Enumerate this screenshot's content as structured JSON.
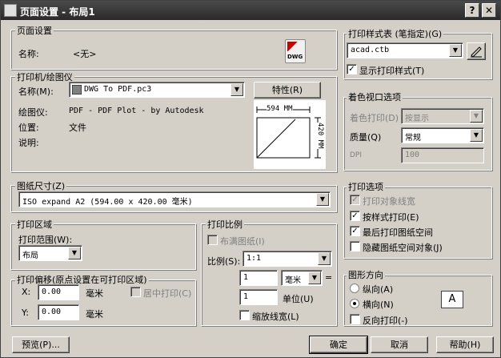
{
  "title": "页面设置 - 布局1",
  "title_buttons": {
    "help": "?",
    "close": "✕"
  },
  "page_setup": {
    "group": "页面设置",
    "name_label": "名称:",
    "name_value": "<无>",
    "dwg_label": "DWG"
  },
  "printer": {
    "group": "打印机/绘图仪",
    "name_label": "名称(M):",
    "name_value": "DWG To PDF.pc3",
    "properties_button": "特性(R)",
    "plotter_label": "绘图仪:",
    "plotter_value": "PDF - PDF Plot - by Autodesk",
    "location_label": "位置:",
    "location_value": "文件",
    "description_label": "说明:",
    "preview_width": "594 MM",
    "preview_height": "420 MM"
  },
  "paper_size": {
    "group": "图纸尺寸(Z)",
    "value": "ISO expand A2 (594.00 x 420.00 毫米)"
  },
  "plot_area": {
    "group": "打印区域",
    "range_label": "打印范围(W):",
    "range_value": "布局"
  },
  "plot_offset": {
    "group": "打印偏移(原点设置在可打印区域)",
    "x_label": "X:",
    "x_value": "0.00",
    "x_unit": "毫米",
    "y_label": "Y:",
    "y_value": "0.00",
    "y_unit": "毫米",
    "center_label": "居中打印(C)"
  },
  "plot_scale": {
    "group": "打印比例",
    "fit_label": "布满图纸(I)",
    "scale_label": "比例(S):",
    "scale_value": "1:1",
    "value1": "1",
    "unit1": "毫米",
    "equals": "=",
    "value2": "1",
    "unit2_label": "单位(U)",
    "lineweights_label": "缩放线宽(L)"
  },
  "plot_style_table": {
    "group": "打印样式表 (笔指定)(G)",
    "value": "acad.ctb",
    "display_label": "显示打印样式(T)"
  },
  "shaded_viewport": {
    "group": "着色视口选项",
    "shade_label": "着色打印(D)",
    "shade_value": "按显示",
    "quality_label": "质量(Q)",
    "quality_value": "常规",
    "dpi_label": "DPI",
    "dpi_value": "100"
  },
  "plot_options": {
    "group": "打印选项",
    "opt1": "打印对象线宽",
    "opt2": "按样式打印(E)",
    "opt3": "最后打印图纸空间",
    "opt4": "隐藏图纸空间对象(J)"
  },
  "orientation": {
    "group": "图形方向",
    "portrait": "纵向(A)",
    "landscape": "横向(N)",
    "reverse": "反向打印(-)",
    "paper_icon_letter": "A"
  },
  "footer": {
    "preview": "预览(P)...",
    "ok": "确定",
    "cancel": "取消",
    "help": "帮助(H)"
  }
}
